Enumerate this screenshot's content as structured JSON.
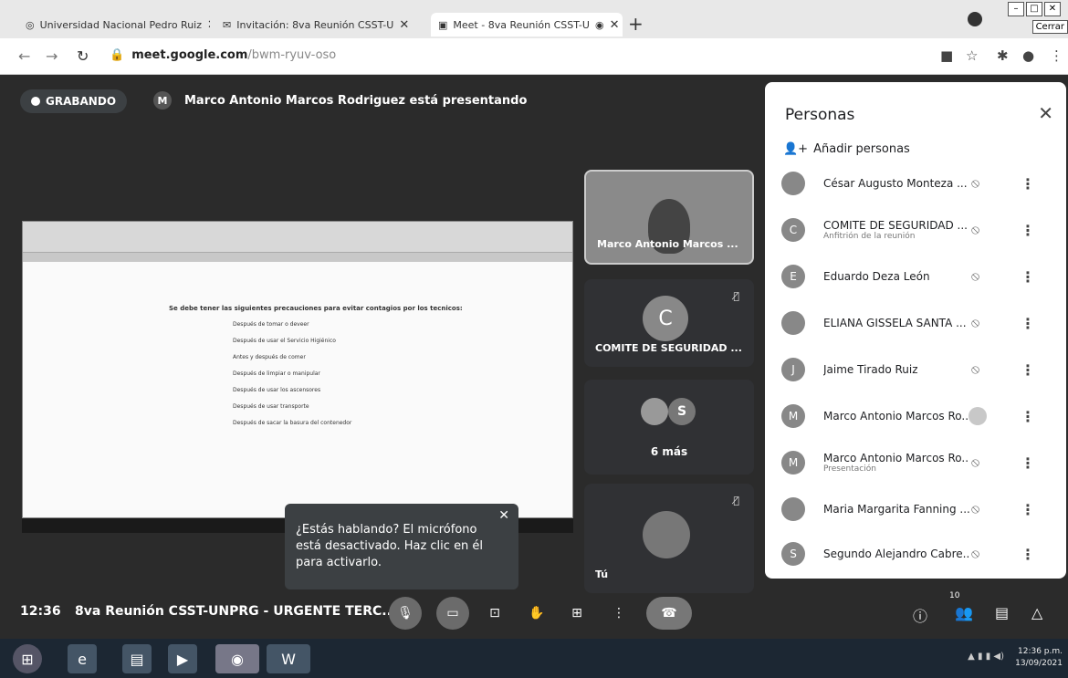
{
  "browser": {
    "tabs": [
      {
        "title": "Universidad Nacional Pedro Ruiz",
        "icon": "globe-icon"
      },
      {
        "title": "Invitación: 8va Reunión CSST-U",
        "icon": "mail-icon"
      },
      {
        "title": "Meet - 8va Reunión CSST-U",
        "icon": "meet-icon"
      }
    ],
    "url_host": "meet.google.com",
    "url_path": "/bwm-ryuv-oso",
    "tooltip": "Cerrar"
  },
  "meet": {
    "recording_label": "GRABANDO",
    "presenter_initial": "M",
    "presenting_text": "Marco Antonio Marcos Rodriguez está presentando",
    "shared_doc": {
      "heading": "Se debe tener las siguientes precauciones para evitar contagios por los tecnicos:",
      "checklist": [
        "Después de tomar o deveer",
        "Después de usar el Servicio Higiénico",
        "Antes y después de comer",
        "Después de limpiar o manipular",
        "Después de usar los ascensores",
        "Después de usar transporte",
        "Después de sacar la basura del contenedor"
      ]
    },
    "tiles": {
      "tile1_name": "Marco Antonio Marcos ...",
      "tile2_initial": "C",
      "tile2_name": "COMITE DE SEGURIDAD ...",
      "tile3_initial": "S",
      "tile3_more": "6 más",
      "tile4_name": "Tú"
    },
    "toast": {
      "text": "¿Estás hablando? El micrófono está desactivado. Haz clic en él para activarlo."
    },
    "people_panel": {
      "title": "Personas",
      "add_label": "Añadir personas",
      "participants": [
        {
          "initial": "",
          "name": "César Augusto Monteza ...",
          "sub": ""
        },
        {
          "initial": "C",
          "name": "COMITE DE SEGURIDAD ...",
          "sub": "Anfitrión de la reunión"
        },
        {
          "initial": "E",
          "name": "Eduardo Deza León",
          "sub": ""
        },
        {
          "initial": "",
          "name": "ELIANA GISSELA SANTA ...",
          "sub": ""
        },
        {
          "initial": "J",
          "name": "Jaime Tirado Ruiz",
          "sub": ""
        },
        {
          "initial": "M",
          "name": "Marco Antonio Marcos Ro...",
          "sub": ""
        },
        {
          "initial": "M",
          "name": "Marco Antonio Marcos Ro...",
          "sub": "Presentación"
        },
        {
          "initial": "",
          "name": "Maria Margarita Fanning ...",
          "sub": ""
        },
        {
          "initial": "S",
          "name": "Segundo Alejandro Cabre...",
          "sub": ""
        }
      ]
    },
    "bottom": {
      "time": "12:36",
      "meeting_title": "8va Reunión CSST-UNPRG - URGENTE TERC...",
      "participants_count": "10"
    }
  },
  "taskbar": {
    "clock_time": "12:36 p.m.",
    "clock_date": "13/09/2021"
  }
}
